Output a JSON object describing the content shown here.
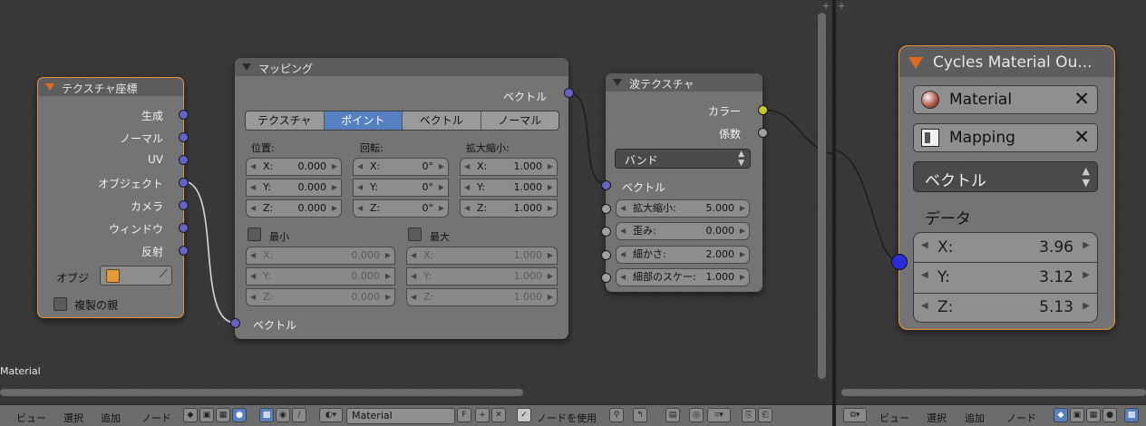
{
  "nodes": {
    "tex_coord": {
      "title": "テクスチャ座標",
      "outputs": [
        "生成",
        "ノーマル",
        "UV",
        "オブジェクト",
        "カメラ",
        "ウィンドウ",
        "反射"
      ],
      "object_label": "オブジ",
      "object_picker_icon": "eyedropper-icon",
      "dupli_label": "複製の親"
    },
    "mapping": {
      "title": "マッピング",
      "output": "ベクトル",
      "modes": [
        "テクスチャ",
        "ポイント",
        "ベクトル",
        "ノーマル"
      ],
      "active_mode": "ポイント",
      "location_label": "位置:",
      "rotation_label": "回転:",
      "scale_label": "拡大縮小:",
      "location": [
        {
          "axis": "X:",
          "value": "0.000"
        },
        {
          "axis": "Y:",
          "value": "0.000"
        },
        {
          "axis": "Z:",
          "value": "0.000"
        }
      ],
      "rotation": [
        {
          "axis": "X:",
          "value": "0°"
        },
        {
          "axis": "Y:",
          "value": "0°"
        },
        {
          "axis": "Z:",
          "value": "0°"
        }
      ],
      "scale": [
        {
          "axis": "X:",
          "value": "1.000"
        },
        {
          "axis": "Y:",
          "value": "1.000"
        },
        {
          "axis": "Z:",
          "value": "1.000"
        }
      ],
      "min_label": "最小",
      "max_label": "最大",
      "min": [
        {
          "axis": "X:",
          "value": "0.000"
        },
        {
          "axis": "Y:",
          "value": "0.000"
        },
        {
          "axis": "Z:",
          "value": "0.000"
        }
      ],
      "max": [
        {
          "axis": "X:",
          "value": "1.000"
        },
        {
          "axis": "Y:",
          "value": "1.000"
        },
        {
          "axis": "Z:",
          "value": "1.000"
        }
      ],
      "input": "ベクトル"
    },
    "wave": {
      "title": "波テクスチャ",
      "outputs": [
        "カラー",
        "係数"
      ],
      "wave_type": "バンド",
      "input_vector": "ベクトル",
      "params": [
        {
          "label": "拡大縮小:",
          "value": "5.000"
        },
        {
          "label": "歪み:",
          "value": "0.000"
        },
        {
          "label": "細かさ:",
          "value": "2.000"
        },
        {
          "label": "細部のスケー:",
          "value": "1.000"
        }
      ]
    },
    "output_panel": {
      "title": "Cycles Material Ou...",
      "material_label": "Material",
      "mapping_label": "Mapping",
      "vector_type": "ベクトル",
      "data_label": "データ",
      "values": [
        {
          "axis": "X:",
          "value": "3.96"
        },
        {
          "axis": "Y:",
          "value": "3.12"
        },
        {
          "axis": "Z:",
          "value": "5.13"
        }
      ]
    }
  },
  "editor_label": "Material",
  "header_left": {
    "menus": [
      "ビュー",
      "選択",
      "追加",
      "ノード"
    ],
    "material_name": "Material",
    "fake_user": "F",
    "use_nodes_label": "ノードを使用"
  },
  "header_right": {
    "menus": [
      "ビュー",
      "選択",
      "追加",
      "ノード"
    ]
  },
  "colors": {
    "vector_socket": "#6363c7",
    "color_socket": "#c7c729",
    "value_socket": "#a1a1a1",
    "active_border": "#e8963a",
    "selected_button": "#5680c2"
  }
}
